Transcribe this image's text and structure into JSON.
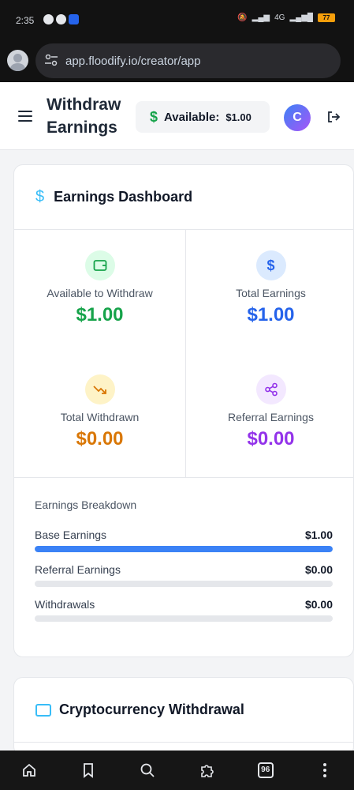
{
  "status_bar": {
    "time": "2:35",
    "battery": "77",
    "network": "4G"
  },
  "browser": {
    "url": "app.floodify.io/creator/app"
  },
  "header": {
    "title": "Withdraw Earnings",
    "available_label": "Available:",
    "available_amount": "$1.00",
    "avatar_initial": "C"
  },
  "dashboard": {
    "title": "Earnings Dashboard",
    "stats": [
      {
        "label": "Available to Withdraw",
        "value": "$1.00",
        "color": "#16a34a",
        "bg": "#dcfce7",
        "icon": "wallet-icon"
      },
      {
        "label": "Total Earnings",
        "value": "$1.00",
        "color": "#2563eb",
        "bg": "#dbeafe",
        "icon": "dollar-icon"
      },
      {
        "label": "Total Withdrawn",
        "value": "$0.00",
        "color": "#d97706",
        "bg": "#fef3c7",
        "icon": "trending-down-icon"
      },
      {
        "label": "Referral Earnings",
        "value": "$0.00",
        "color": "#9333ea",
        "bg": "#f3e8ff",
        "icon": "share-icon"
      }
    ],
    "breakdown": {
      "title": "Earnings Breakdown",
      "rows": [
        {
          "label": "Base Earnings",
          "value": "$1.00",
          "fraction": 1.0
        },
        {
          "label": "Referral Earnings",
          "value": "$0.00",
          "fraction": 0.0
        },
        {
          "label": "Withdrawals",
          "value": "$0.00",
          "fraction": 0.0
        }
      ]
    }
  },
  "crypto": {
    "title": "Cryptocurrency Withdrawal"
  },
  "bottom_nav": {
    "tab_count": "96"
  },
  "colors": {
    "accent": "#3b82f6",
    "green": "#16a34a",
    "blue": "#2563eb",
    "orange": "#d97706",
    "purple": "#9333ea"
  }
}
